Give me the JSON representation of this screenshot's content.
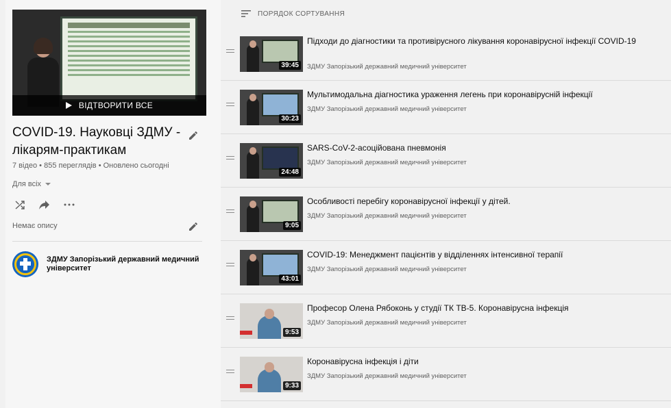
{
  "playlist": {
    "play_all_label": "ВІДТВОРИТИ ВСЕ",
    "title": "COVID-19. Науковці ЗДМУ - лікарям-практикам",
    "stats": "7 відео • 855 переглядів • Оновлено сьогодні",
    "privacy": "Для всіх",
    "description": "Немає опису",
    "channel": "ЗДМУ Запорізький державний медичний університет"
  },
  "sort_label": "ПОРЯДОК СОРТУВАННЯ",
  "videos": [
    {
      "title": "Підходи до діагностики та противірусного лікування коронавірусної інфекції COVID-19",
      "channel": "ЗДМУ Запорізький державний медичний університет",
      "duration": "39:45"
    },
    {
      "title": "Мультимодальна діагностика ураження легень при коронавірусній інфекції",
      "channel": "ЗДМУ Запорізький державний медичний університет",
      "duration": "30:23"
    },
    {
      "title": "SARS-CoV-2-асоційована пневмонія",
      "channel": "ЗДМУ Запорізький державний медичний університет",
      "duration": "24:48"
    },
    {
      "title": "Особливості перебігу коронавірусної інфекції у дітей.",
      "channel": "ЗДМУ Запорізький державний медичний університет",
      "duration": "9:05"
    },
    {
      "title": "COVID-19: Менеджмент пацієнтів у відділеннях інтенсивної терапії",
      "channel": "ЗДМУ Запорізький державний медичний університет",
      "duration": "43:01"
    },
    {
      "title": "Професор Олена Рябоконь у студії ТК ТВ-5. Коронавірусна інфекція",
      "channel": "ЗДМУ Запорізький державний медичний університет",
      "duration": "9:53"
    },
    {
      "title": "Коронавірусна інфекція і діти",
      "channel": "ЗДМУ Запорізький державний медичний університет",
      "duration": "9:33"
    }
  ]
}
